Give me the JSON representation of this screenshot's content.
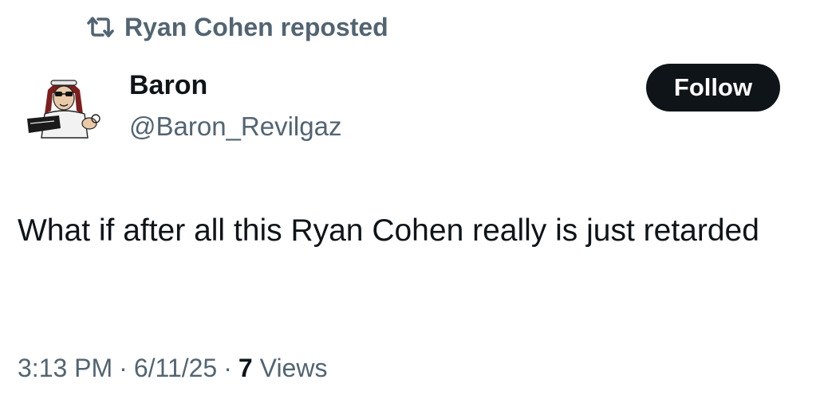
{
  "repost": {
    "icon": "repost-icon",
    "label": "Ryan Cohen reposted"
  },
  "author": {
    "name": "Baron",
    "handle": "@Baron_Revilgaz",
    "avatar_icon": "avatar-illustration"
  },
  "follow_label": "Follow",
  "tweet": {
    "text": "What if after all this Ryan Cohen really is just retarded"
  },
  "meta": {
    "time": "3:13 PM",
    "separator": "·",
    "date": "6/11/25",
    "views_count": "7",
    "views_label": "Views"
  },
  "colors": {
    "text_primary": "#0f1419",
    "text_secondary": "#536471",
    "button_bg": "#0f1419",
    "button_text": "#ffffff"
  }
}
